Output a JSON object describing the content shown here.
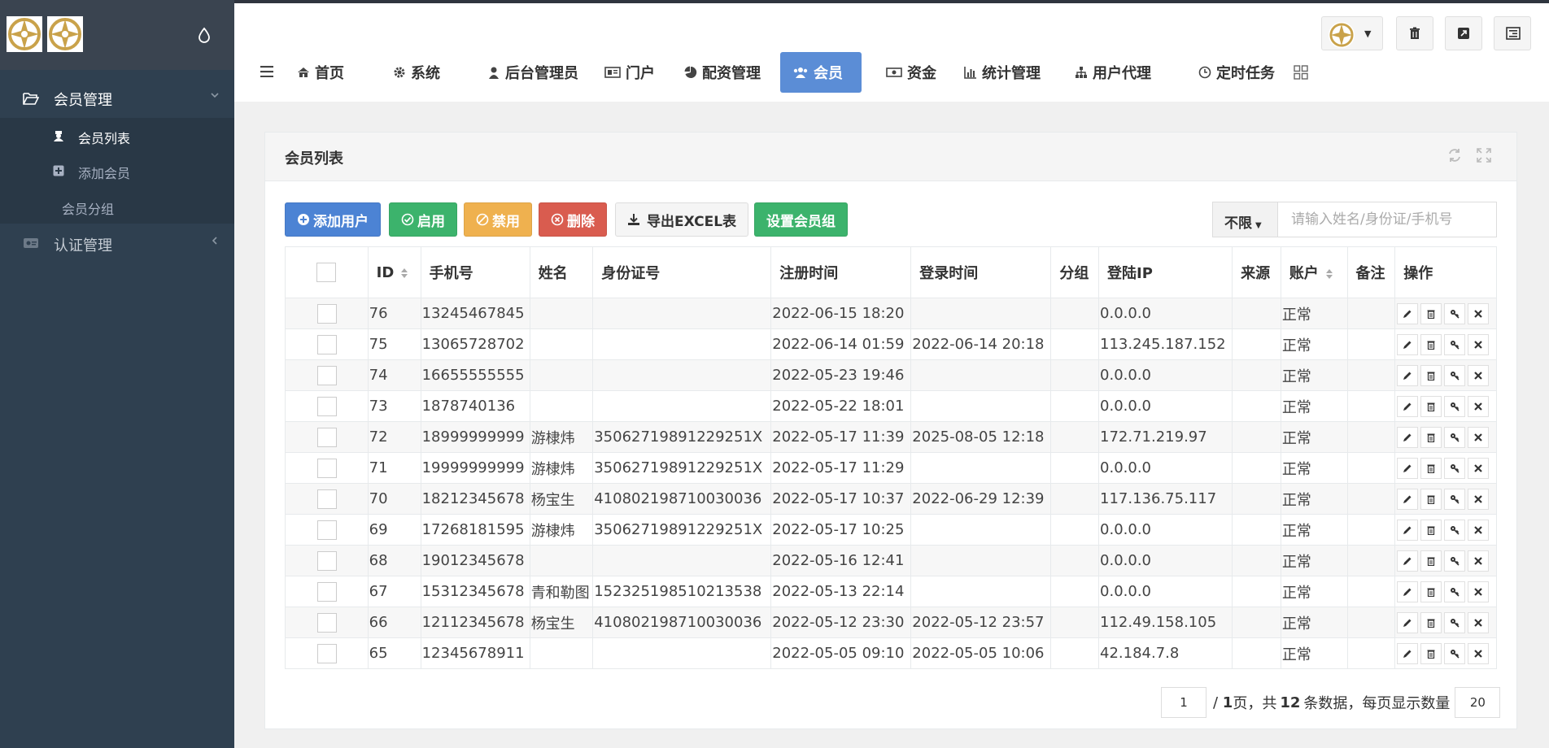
{
  "sidebar": {
    "groups": [
      {
        "label": "会员管理",
        "icon": "folder-open-icon",
        "expanded": true
      },
      {
        "label": "认证管理",
        "icon": "id-card-icon",
        "expanded": false
      }
    ],
    "subitems": [
      {
        "label": "会员列表",
        "icon": "user-secret-icon",
        "active": true
      },
      {
        "label": "添加会员",
        "icon": "plus-square-icon",
        "active": false
      },
      {
        "label": "会员分组",
        "icon": "",
        "active": false
      }
    ]
  },
  "topnav": {
    "tabs": [
      {
        "label": "首页",
        "icon": "home-icon"
      },
      {
        "label": "系统",
        "icon": "gear-icon"
      },
      {
        "label": "后台管理员",
        "icon": "user-icon"
      },
      {
        "label": "门户",
        "icon": "newspaper-icon"
      },
      {
        "label": "配资管理",
        "icon": "pie-chart-icon"
      },
      {
        "label": "会员",
        "icon": "users-icon",
        "active": true
      },
      {
        "label": "资金",
        "icon": "money-icon"
      },
      {
        "label": "统计管理",
        "icon": "bar-chart-icon"
      },
      {
        "label": "用户代理",
        "icon": "sitemap-icon"
      },
      {
        "label": "定时任务",
        "icon": "clock-icon"
      }
    ]
  },
  "panel": {
    "title": "会员列表"
  },
  "toolbar": {
    "add_label": "添加用户",
    "enable_label": "启用",
    "disable_label": "禁用",
    "delete_label": "删除",
    "export_label": "导出EXCEL表",
    "group_label": "设置会员组"
  },
  "search": {
    "filter": "不限",
    "placeholder": "请输入姓名/身份证/手机号"
  },
  "table": {
    "headers": [
      "ID",
      "手机号",
      "姓名",
      "身份证号",
      "注册时间",
      "登录时间",
      "分组",
      "登陆IP",
      "来源",
      "账户",
      "备注",
      "操作"
    ],
    "rows": [
      {
        "id": "76",
        "phone": "13245467845",
        "name": "",
        "idcard": "",
        "reg": "2022-06-15 18:20",
        "login": "",
        "group": "",
        "ip": "0.0.0.0",
        "src": "",
        "status": "正常",
        "note": ""
      },
      {
        "id": "75",
        "phone": "13065728702",
        "name": "",
        "idcard": "",
        "reg": "2022-06-14 01:59",
        "login": "2022-06-14 20:18",
        "group": "",
        "ip": "113.245.187.152",
        "src": "",
        "status": "正常",
        "note": ""
      },
      {
        "id": "74",
        "phone": "16655555555",
        "name": "",
        "idcard": "",
        "reg": "2022-05-23 19:46",
        "login": "",
        "group": "",
        "ip": "0.0.0.0",
        "src": "",
        "status": "正常",
        "note": ""
      },
      {
        "id": "73",
        "phone": "1878740136",
        "name": "",
        "idcard": "",
        "reg": "2022-05-22 18:01",
        "login": "",
        "group": "",
        "ip": "0.0.0.0",
        "src": "",
        "status": "正常",
        "note": ""
      },
      {
        "id": "72",
        "phone": "18999999999",
        "name": "游棣炜",
        "idcard": "35062719891229251X",
        "reg": "2022-05-17 11:39",
        "login": "2025-08-05 12:18",
        "group": "",
        "ip": "172.71.219.97",
        "src": "",
        "status": "正常",
        "note": ""
      },
      {
        "id": "71",
        "phone": "19999999999",
        "name": "游棣炜",
        "idcard": "35062719891229251X",
        "reg": "2022-05-17 11:29",
        "login": "",
        "group": "",
        "ip": "0.0.0.0",
        "src": "",
        "status": "正常",
        "note": ""
      },
      {
        "id": "70",
        "phone": "18212345678",
        "name": "杨宝生",
        "idcard": "410802198710030036",
        "reg": "2022-05-17 10:37",
        "login": "2022-06-29 12:39",
        "group": "",
        "ip": "117.136.75.117",
        "src": "",
        "status": "正常",
        "note": ""
      },
      {
        "id": "69",
        "phone": "17268181595",
        "name": "游棣炜",
        "idcard": "35062719891229251X",
        "reg": "2022-05-17 10:25",
        "login": "",
        "group": "",
        "ip": "0.0.0.0",
        "src": "",
        "status": "正常",
        "note": ""
      },
      {
        "id": "68",
        "phone": "19012345678",
        "name": "",
        "idcard": "",
        "reg": "2022-05-16 12:41",
        "login": "",
        "group": "",
        "ip": "0.0.0.0",
        "src": "",
        "status": "正常",
        "note": ""
      },
      {
        "id": "67",
        "phone": "15312345678",
        "name": "青和勒图",
        "idcard": "152325198510213538",
        "reg": "2022-05-13 22:14",
        "login": "",
        "group": "",
        "ip": "0.0.0.0",
        "src": "",
        "status": "正常",
        "note": ""
      },
      {
        "id": "66",
        "phone": "12112345678",
        "name": "杨宝生",
        "idcard": "410802198710030036",
        "reg": "2022-05-12 23:30",
        "login": "2022-05-12 23:57",
        "group": "",
        "ip": "112.49.158.105",
        "src": "",
        "status": "正常",
        "note": ""
      },
      {
        "id": "65",
        "phone": "12345678911",
        "name": "",
        "idcard": "",
        "reg": "2022-05-05 09:10",
        "login": "2022-05-05 10:06",
        "group": "",
        "ip": "42.184.7.8",
        "src": "",
        "status": "正常",
        "note": ""
      }
    ]
  },
  "pagination": {
    "current_page": "1",
    "total_pages": "1",
    "page_unit": "页，共",
    "total_records": "12",
    "records_text": "条数据，每页显示数量",
    "page_size": "20"
  },
  "colors": {
    "sidebar": "#2f4050",
    "active_tab": "#5b8dd6",
    "blue": "#4c83d4",
    "green": "#3cb36c",
    "orange": "#efb14f",
    "red": "#d95c4f"
  }
}
